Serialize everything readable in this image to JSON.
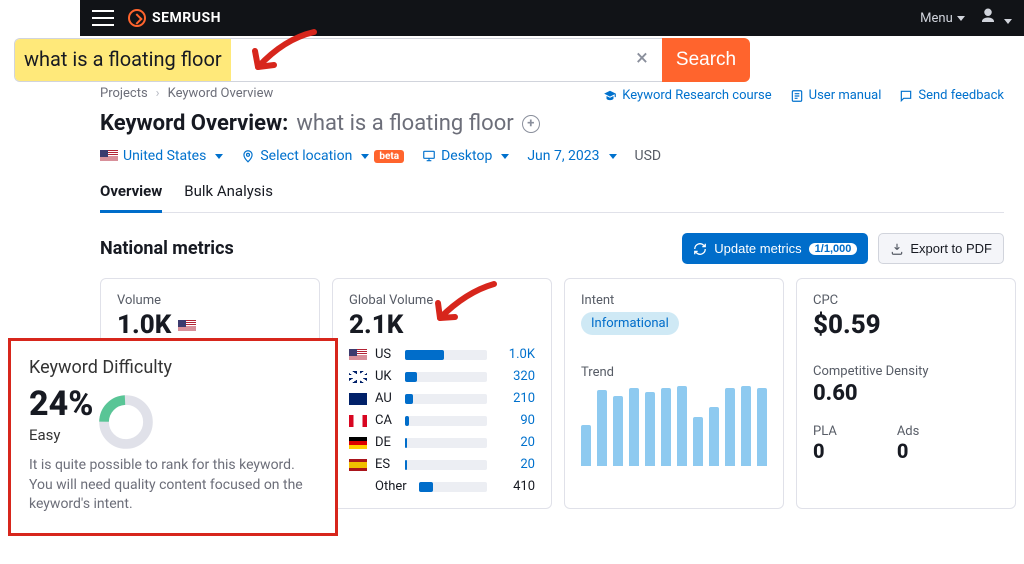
{
  "topbar": {
    "brand": "SEMRUSH",
    "menu": "Menu"
  },
  "search": {
    "query": "what is a floating floor",
    "button": "Search"
  },
  "breadcrumb": {
    "root": "Projects",
    "page": "Keyword Overview"
  },
  "helplinks": {
    "course": "Keyword Research course",
    "manual": "User manual",
    "feedback": "Send feedback"
  },
  "title": {
    "prefix": "Keyword Overview:",
    "keyword": "what is a floating floor"
  },
  "filters": {
    "country": "United States",
    "location": "Select location",
    "location_badge": "beta",
    "device": "Desktop",
    "date": "Jun 7, 2023",
    "currency": "USD"
  },
  "tabs": {
    "overview": "Overview",
    "bulk": "Bulk Analysis"
  },
  "section": {
    "national": "National metrics"
  },
  "buttons": {
    "update": "Update metrics",
    "update_count": "1/1,000",
    "export": "Export to PDF"
  },
  "volume": {
    "label": "Volume",
    "value": "1.0K"
  },
  "global": {
    "label": "Global Volume",
    "value": "2.1K",
    "rows": [
      {
        "cc": "US",
        "flag": "flag-us",
        "pct": 48,
        "val": "1.0K"
      },
      {
        "cc": "UK",
        "flag": "flag-uk",
        "pct": 15,
        "val": "320"
      },
      {
        "cc": "AU",
        "flag": "flag-au",
        "pct": 10,
        "val": "210"
      },
      {
        "cc": "CA",
        "flag": "flag-ca",
        "pct": 5,
        "val": "90"
      },
      {
        "cc": "DE",
        "flag": "flag-de",
        "pct": 3,
        "val": "20"
      },
      {
        "cc": "ES",
        "flag": "flag-es",
        "pct": 3,
        "val": "20"
      }
    ],
    "other_label": "Other",
    "other_pct": 20,
    "other_val": "410"
  },
  "intent": {
    "label": "Intent",
    "value": "Informational"
  },
  "trend": {
    "label": "Trend",
    "bars": [
      42,
      78,
      72,
      80,
      76,
      80,
      82,
      50,
      60,
      80,
      82,
      80
    ]
  },
  "cpc": {
    "label": "CPC",
    "value": "$0.59"
  },
  "cd": {
    "label": "Competitive Density",
    "value": "0.60",
    "pla_label": "PLA",
    "pla_value": "0",
    "ads_label": "Ads",
    "ads_value": "0"
  },
  "kd": {
    "label": "Keyword Difficulty",
    "value": "24%",
    "level": "Easy",
    "desc": "It is quite possible to rank for this keyword. You will need quality content focused on the keyword's intent."
  }
}
